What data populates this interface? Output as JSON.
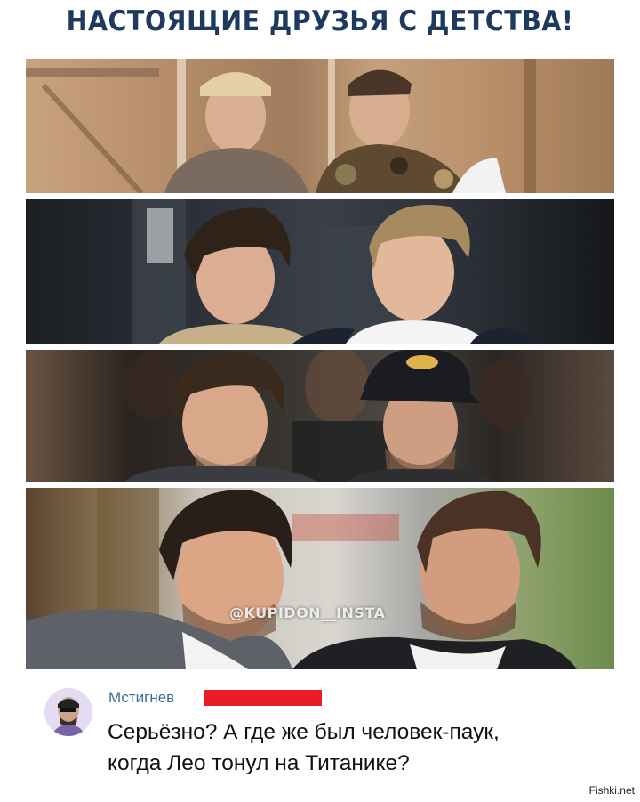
{
  "header": {
    "title": "НАСТОЯЩИЕ ДРУЗЬЯ С ДЕТСТВА!"
  },
  "panels": [
    {
      "name": "childhood-photo"
    },
    {
      "name": "teen-photo"
    },
    {
      "name": "adult-photo"
    },
    {
      "name": "recent-photo"
    }
  ],
  "watermark": {
    "text": "@KUPIDON__INSTA"
  },
  "comment": {
    "author": "Мстигнев",
    "line1": "Серьёзно? А где же был человек-паук,",
    "line2": "когда Лео тонул на Титанике?"
  },
  "footer": {
    "source": "Fishki.net"
  }
}
